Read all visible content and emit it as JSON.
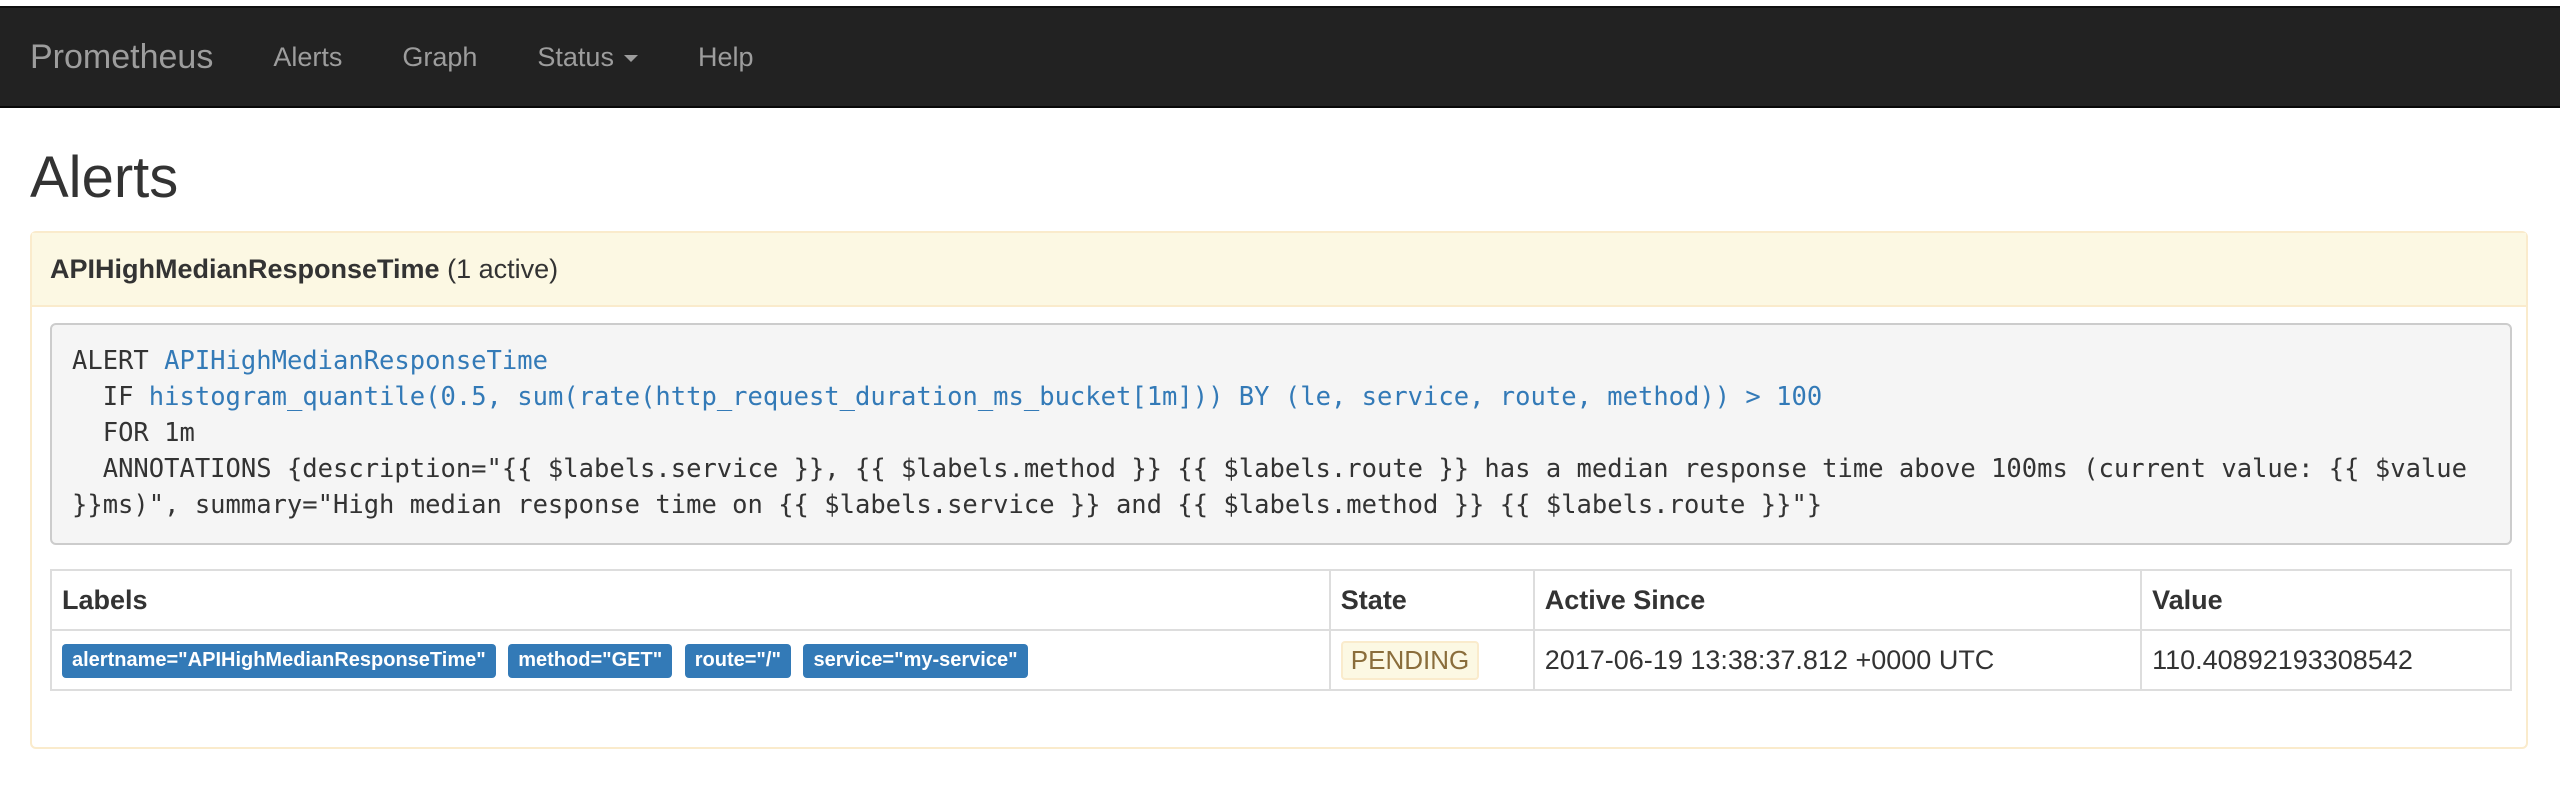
{
  "navbar": {
    "brand": "Prometheus",
    "items": [
      {
        "label": "Alerts"
      },
      {
        "label": "Graph"
      },
      {
        "label": "Status"
      },
      {
        "label": "Help"
      }
    ]
  },
  "page_title": "Alerts",
  "alert_group": {
    "name": "APIHighMedianResponseTime",
    "active_count": "(1 active)",
    "rule": {
      "alert_kw": "ALERT",
      "alert_name": "APIHighMedianResponseTime",
      "if_kw": "IF",
      "expr": "histogram_quantile(0.5, sum(rate(http_request_duration_ms_bucket[1m])) BY (le, service, route, method)) > 100",
      "for_line": "FOR 1m",
      "annotations": "ANNOTATIONS {description=\"{{ $labels.service }}, {{ $labels.method }} {{ $labels.route }} has a median response time above 100ms (current value: {{ $value }}ms)\", summary=\"High median response time on {{ $labels.service }} and {{ $labels.method }} {{ $labels.route }}\"}"
    },
    "table": {
      "headers": [
        "Labels",
        "State",
        "Active Since",
        "Value"
      ],
      "rows": [
        {
          "labels": [
            "alertname=\"APIHighMedianResponseTime\"",
            "method=\"GET\"",
            "route=\"/\"",
            "service=\"my-service\""
          ],
          "state": "PENDING",
          "active_since": "2017-06-19 13:38:37.812 +0000 UTC",
          "value": "110.40892193308542"
        }
      ]
    }
  },
  "colors": {
    "navbar_bg": "#222222",
    "pending_bg": "#fcf8e3",
    "pending_border": "#faebcc",
    "label_bg": "#337ab7",
    "link": "#337ab7"
  }
}
